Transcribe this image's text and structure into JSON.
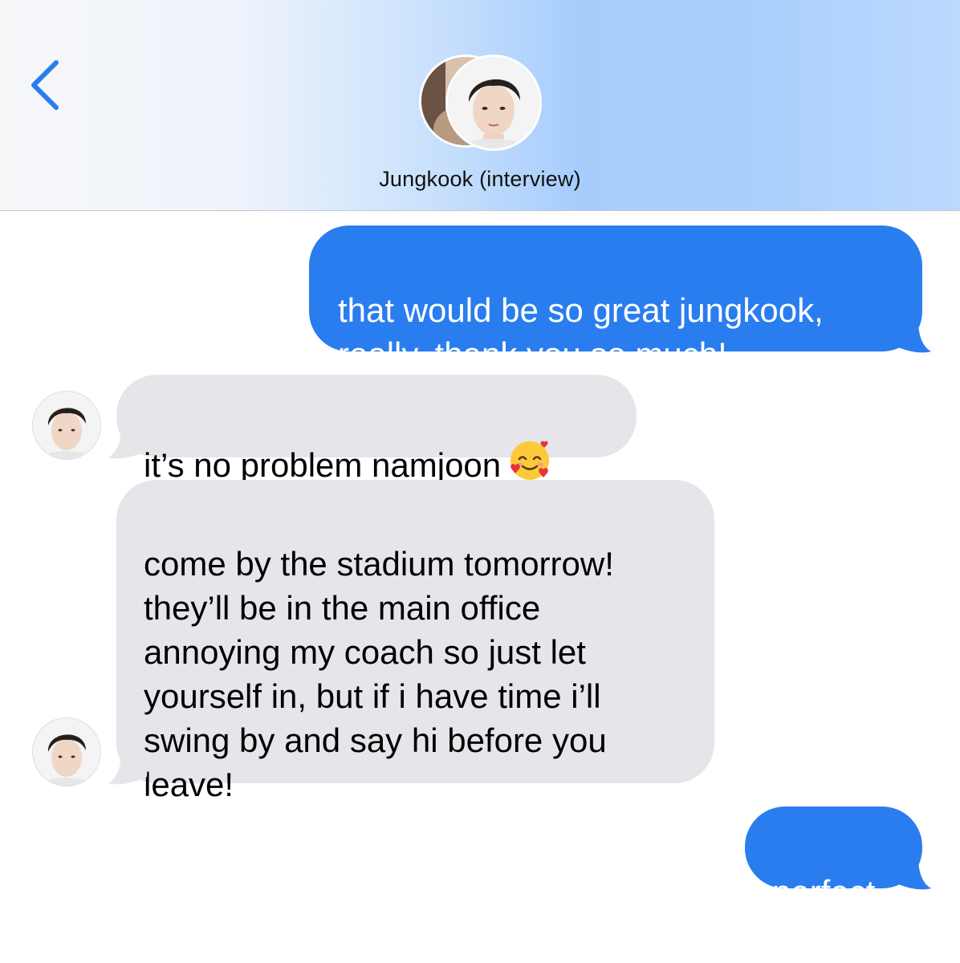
{
  "header": {
    "contact_name": "Jungkook (interview)",
    "back_icon": "chevron-left-icon",
    "accent_color": "#2a7dee"
  },
  "messages": [
    {
      "direction": "sent",
      "text": "that would be so great jungkook,\nreally, thank you so much!"
    },
    {
      "direction": "received",
      "text": "it’s no problem namjoon",
      "emoji": "smiling-face-with-hearts-icon"
    },
    {
      "direction": "received",
      "text": "come by the stadium tomorrow!\nthey’ll be in the main office\nannoying my coach so just let\nyourself in, but if i have time i’ll\nswing by and say hi before you\nleave!"
    },
    {
      "direction": "sent",
      "text": "perfect"
    }
  ],
  "colors": {
    "sent_bubble": "#2a7dee",
    "received_bubble": "#e5e5ea"
  }
}
